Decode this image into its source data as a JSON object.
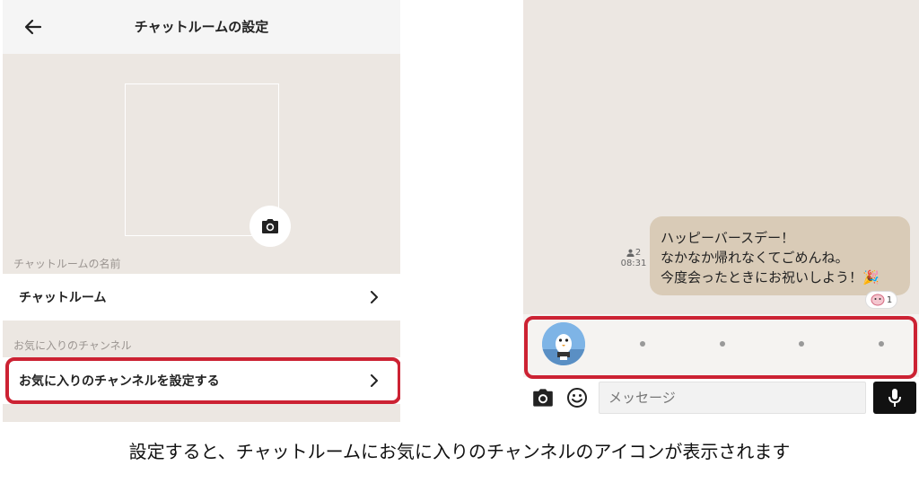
{
  "left": {
    "header": {
      "title": "チャットルームの設定",
      "back_icon": "arrow-left-icon"
    },
    "room_name_section_label": "チャットルームの名前",
    "room_name_value": "チャットルーム",
    "favorite_section_label": "お気に入りのチャンネル",
    "favorite_setting_label": "お気に入りのチャンネルを設定する"
  },
  "right": {
    "message": {
      "lines": [
        "ハッピーバースデー！",
        "なかなか帰れなくてごめんね。",
        "今度会ったときにお祝いしよう！🎉"
      ],
      "read_count": "2",
      "time": "08:31",
      "reaction_count": "1"
    },
    "favorite_bar": {
      "dot_count": 4
    },
    "input": {
      "placeholder": "メッセージ"
    }
  },
  "caption": "設定すると、チャットルームにお気に入りのチャンネルのアイコンが表示されます",
  "colors": {
    "highlight": "#cc2233",
    "chat_bg": "#ece7e2",
    "bubble": "#d9cbb7"
  }
}
